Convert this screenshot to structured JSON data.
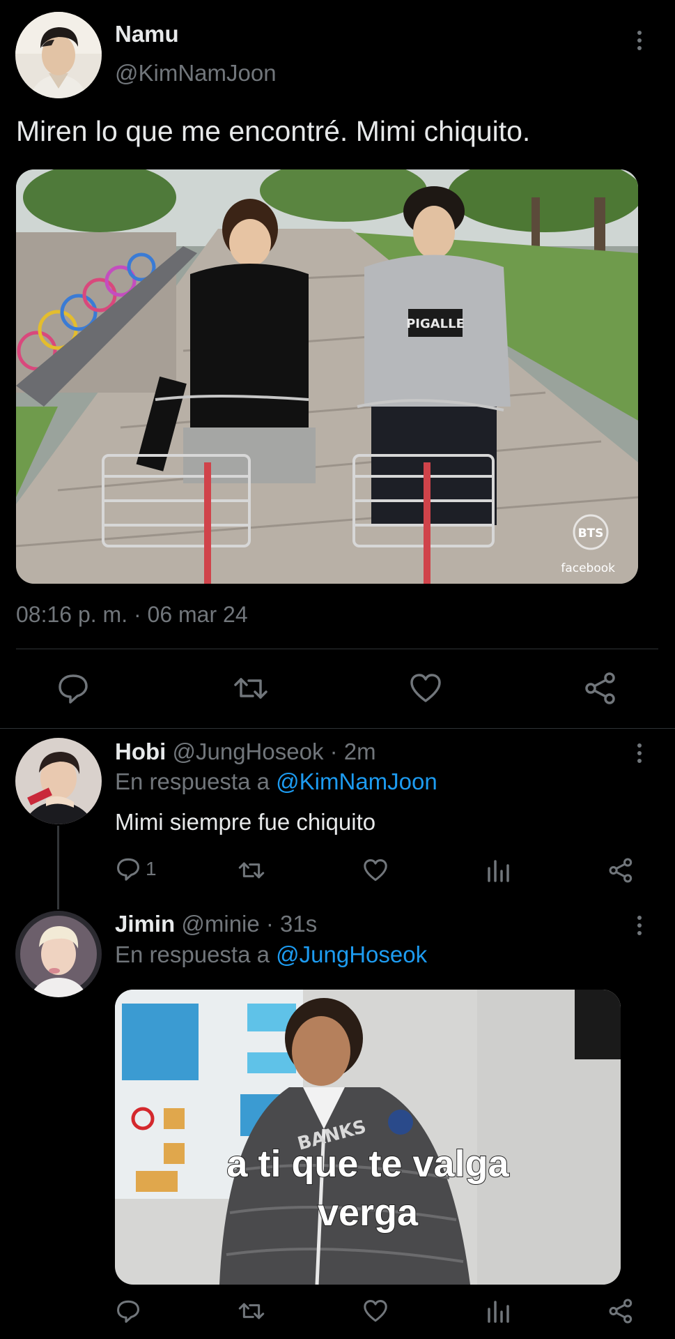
{
  "main_tweet": {
    "display_name": "Namu",
    "handle": "@KimNamJoon",
    "text": "Miren lo que me encontré. Mimi chiquito.",
    "photo_overlay": {
      "logo": "BTS",
      "source": "facebook"
    },
    "timestamp": "08:16 p. m. · 06 mar 24",
    "actions": [
      "reply-icon",
      "retweet-icon",
      "like-icon",
      "share-icon"
    ]
  },
  "replies": [
    {
      "display_name": "Hobi",
      "handle_time": "@JungHoseok · 2m",
      "reply_prefix": "En respuesta a",
      "reply_to": "@KimNamJoon",
      "text": "Mimi siempre fue chiquito",
      "reply_count": "1"
    },
    {
      "display_name": "Jimin",
      "handle_time": "@minie · 31s",
      "reply_prefix": "En respuesta a",
      "reply_to": "@JungHoseok",
      "meme_caption_line1": "a ti que te valga",
      "meme_caption_line2": "verga",
      "sign_letters": "BANKS"
    }
  ],
  "colors": {
    "background": "#000000",
    "text": "#e7e9ea",
    "muted": "#71767b",
    "link": "#1d9bf0",
    "divider": "#2f3336"
  }
}
